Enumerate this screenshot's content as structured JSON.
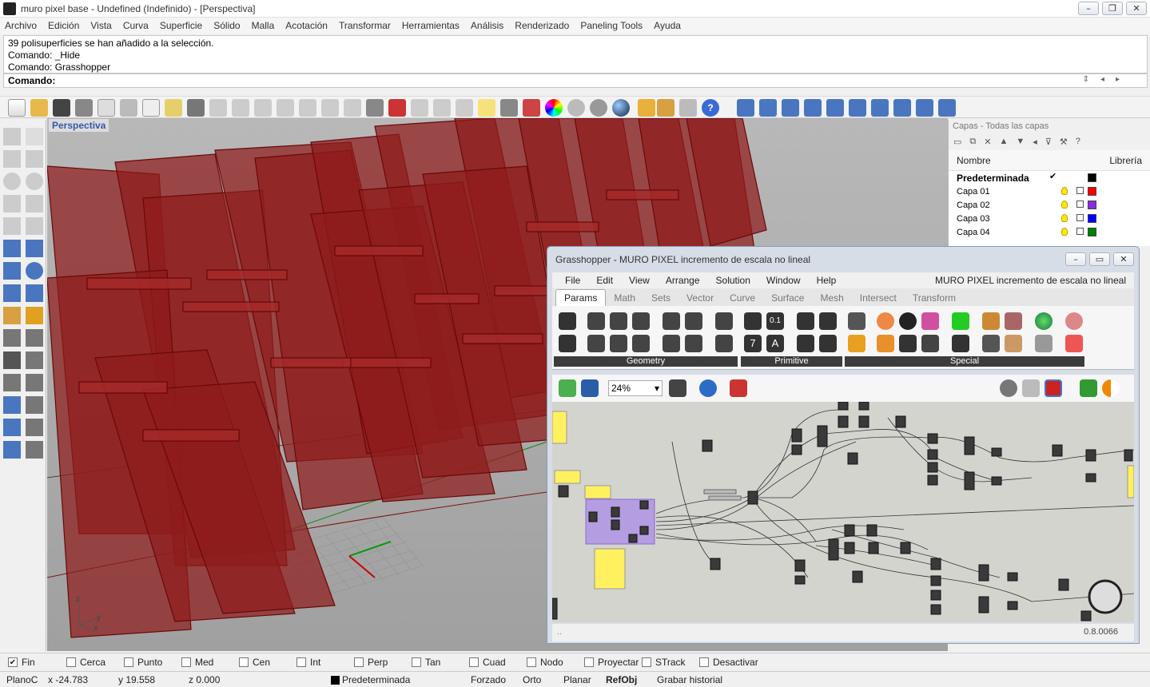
{
  "window": {
    "title": "muro pixel base - Undefined (Indefinido) - [Perspectiva]"
  },
  "menu": [
    "Archivo",
    "Edición",
    "Vista",
    "Curva",
    "Superficie",
    "Sólido",
    "Malla",
    "Acotación",
    "Transformar",
    "Herramientas",
    "Análisis",
    "Renderizado",
    "Paneling Tools",
    "Ayuda"
  ],
  "command": {
    "history": [
      "39 polisuperficies se han añadido a la selección.",
      "Comando: _Hide",
      "Comando: Grasshopper"
    ],
    "prompt": "Comando:"
  },
  "viewport": {
    "label": "Perspectiva",
    "axis_z": "z",
    "axis_y": "y",
    "axis_x": "x"
  },
  "layers": {
    "title": "Capas - Todas las capas",
    "col_name": "Nombre",
    "col_library": "Librería",
    "rows": [
      {
        "name": "Predeterminada",
        "color": "#000000",
        "current": true
      },
      {
        "name": "Capa 01",
        "color": "#ff0000"
      },
      {
        "name": "Capa 02",
        "color": "#8a2be2"
      },
      {
        "name": "Capa 03",
        "color": "#0000ff"
      },
      {
        "name": "Capa 04",
        "color": "#008000"
      }
    ]
  },
  "grasshopper": {
    "title": "Grasshopper - MURO PIXEL incremento de escala no lineal",
    "menu": [
      "File",
      "Edit",
      "View",
      "Arrange",
      "Solution",
      "Window",
      "Help"
    ],
    "doc_name": "MURO PIXEL incremento de escala no lineal",
    "tabs": [
      "Params",
      "Math",
      "Sets",
      "Vector",
      "Curve",
      "Surface",
      "Mesh",
      "Intersect",
      "Transform"
    ],
    "groups": [
      "Geometry",
      "Primitive",
      "Special"
    ],
    "zoom": "24%",
    "version": "0.8.0066",
    "status_dots": "..",
    "primitive_glyphs": {
      "num": "0.1",
      "seven": "7",
      "letter": "A"
    }
  },
  "snaps": [
    {
      "label": "Fin",
      "checked": true
    },
    {
      "label": "Cerca",
      "checked": false
    },
    {
      "label": "Punto",
      "checked": false
    },
    {
      "label": "Med",
      "checked": false
    },
    {
      "label": "Cen",
      "checked": false
    },
    {
      "label": "Int",
      "checked": false
    },
    {
      "label": "Perp",
      "checked": false
    },
    {
      "label": "Tan",
      "checked": false
    },
    {
      "label": "Cuad",
      "checked": false
    },
    {
      "label": "Nodo",
      "checked": false
    },
    {
      "label": "Proyectar",
      "checked": false
    },
    {
      "label": "STrack",
      "checked": false
    },
    {
      "label": "Desactivar",
      "checked": false
    }
  ],
  "status": {
    "plane": "PlanoC",
    "x": "x -24.783",
    "y": "y 19.558",
    "z": "z 0.000",
    "layer": "Predeterminada",
    "forzado": "Forzado",
    "orto": "Orto",
    "planar": "Planar",
    "refobj": "RefObj",
    "history": "Grabar historial"
  }
}
